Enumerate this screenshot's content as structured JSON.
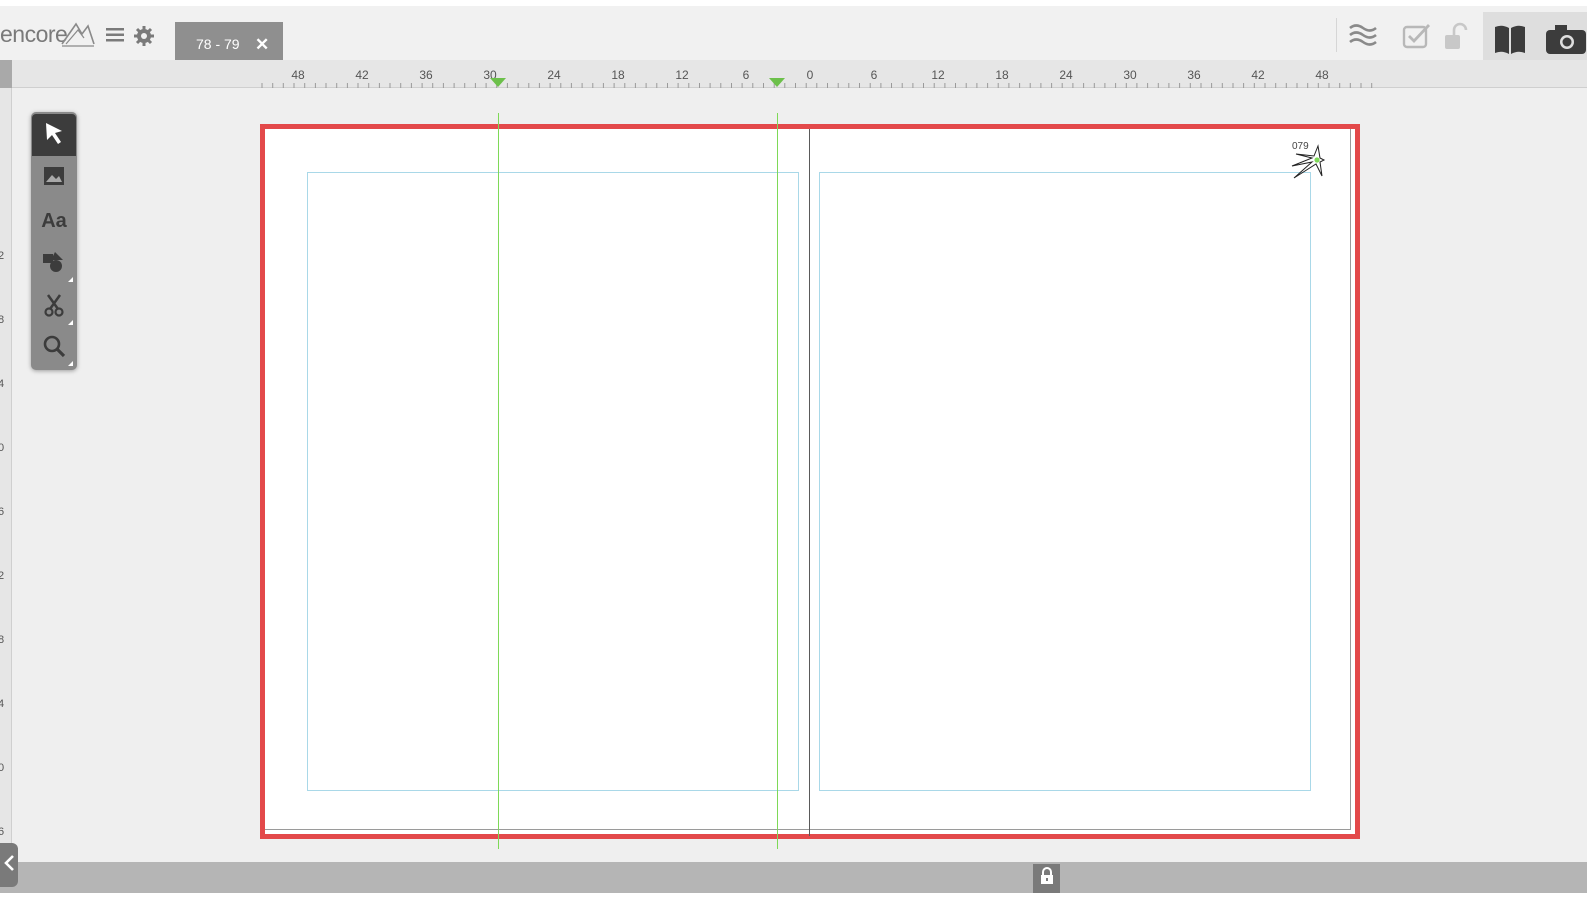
{
  "app": {
    "logo_text": "encore"
  },
  "tabs": [
    {
      "label": "78 - 79",
      "close_symbol": "✕"
    }
  ],
  "ruler": {
    "top_labels": [
      "48",
      "42",
      "36",
      "30",
      "24",
      "18",
      "12",
      "6",
      "0",
      "6",
      "12",
      "18",
      "24",
      "30",
      "36",
      "42",
      "48"
    ],
    "left_labels": [
      "2",
      "8",
      "4",
      "0",
      "6",
      "2",
      "8",
      "4",
      "0",
      "6"
    ]
  },
  "tools": [
    {
      "name": "select-tool",
      "icon": "arrow-icon",
      "active": true
    },
    {
      "name": "image-tool",
      "icon": "image-icon"
    },
    {
      "name": "text-tool",
      "icon": "text-icon",
      "label": "Aa"
    },
    {
      "name": "shape-tool",
      "icon": "shapes-icon"
    },
    {
      "name": "cut-tool",
      "icon": "scissors-icon"
    },
    {
      "name": "zoom-tool",
      "icon": "magnifier-icon"
    }
  ],
  "page": {
    "folio": "079"
  },
  "colors": {
    "spread_border": "#e3494a",
    "guide": "#7ed957",
    "margin": "#a9d8e8",
    "toolbar": "#8a8a8a"
  }
}
